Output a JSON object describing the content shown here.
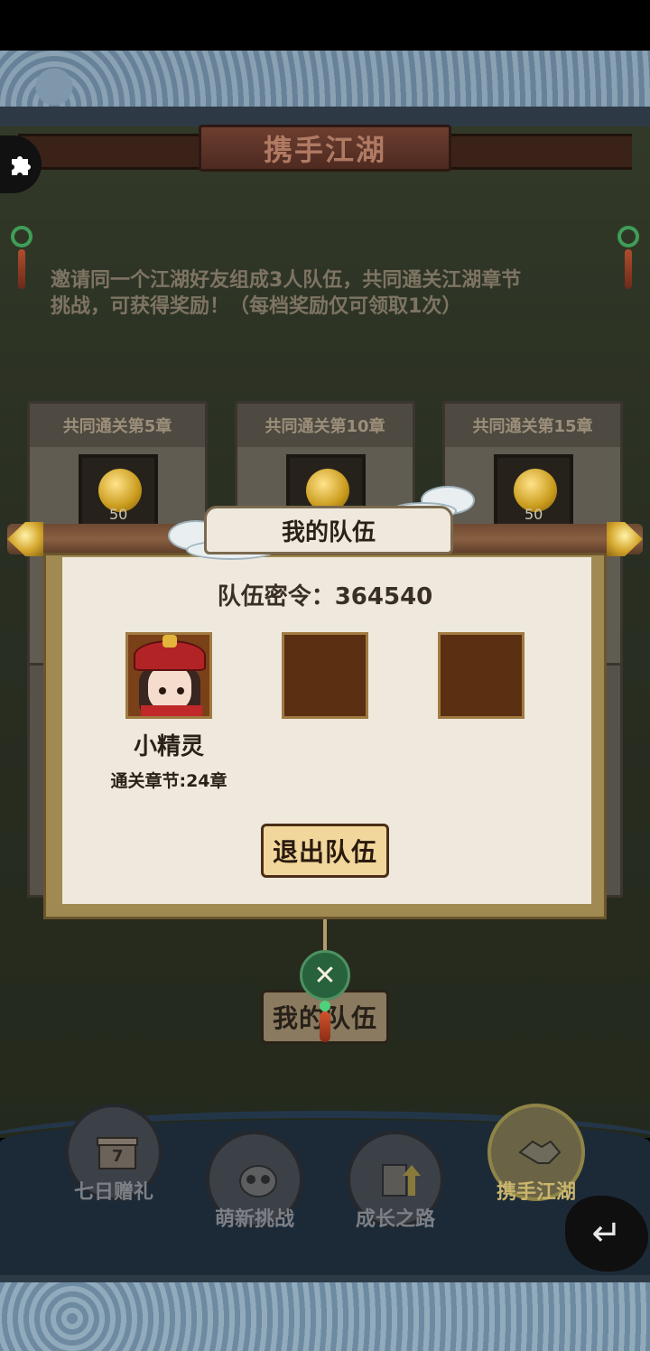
{
  "header": {
    "title": "携手江湖"
  },
  "intro": {
    "line1": "邀请同一个江湖好友组成3人队伍，共同通关江湖章节",
    "line2": "挑战，可获得奖励！（每档奖励仅可领取1次）"
  },
  "rewards": [
    {
      "label": "共同通关第5章",
      "count": "50"
    },
    {
      "label": "共同通关第10章",
      "count": "50"
    },
    {
      "label": "共同通关第15章",
      "count": "50"
    }
  ],
  "background_button": {
    "label": "我的队伍"
  },
  "modal": {
    "title": "我的队伍",
    "team_code": "队伍密令：364540",
    "member": {
      "name": "小精灵",
      "progress": "通关章节:24章"
    },
    "leave_label": "退出队伍",
    "close_glyph": "✕"
  },
  "nav": [
    {
      "label": "七日赠礼",
      "icon": "gift-box-icon",
      "active": false
    },
    {
      "label": "萌新挑战",
      "icon": "mask-icon",
      "active": false
    },
    {
      "label": "成长之路",
      "icon": "book-arrow-icon",
      "active": false
    },
    {
      "label": "携手江湖",
      "icon": "handshake-icon",
      "active": true
    }
  ],
  "colors": {
    "accent_gold": "#f1d79b",
    "modal_paper": "#efe9dd",
    "frame_brown": "#a08a52",
    "close_green": "#27623c",
    "nav_active": "#c9b56d"
  }
}
